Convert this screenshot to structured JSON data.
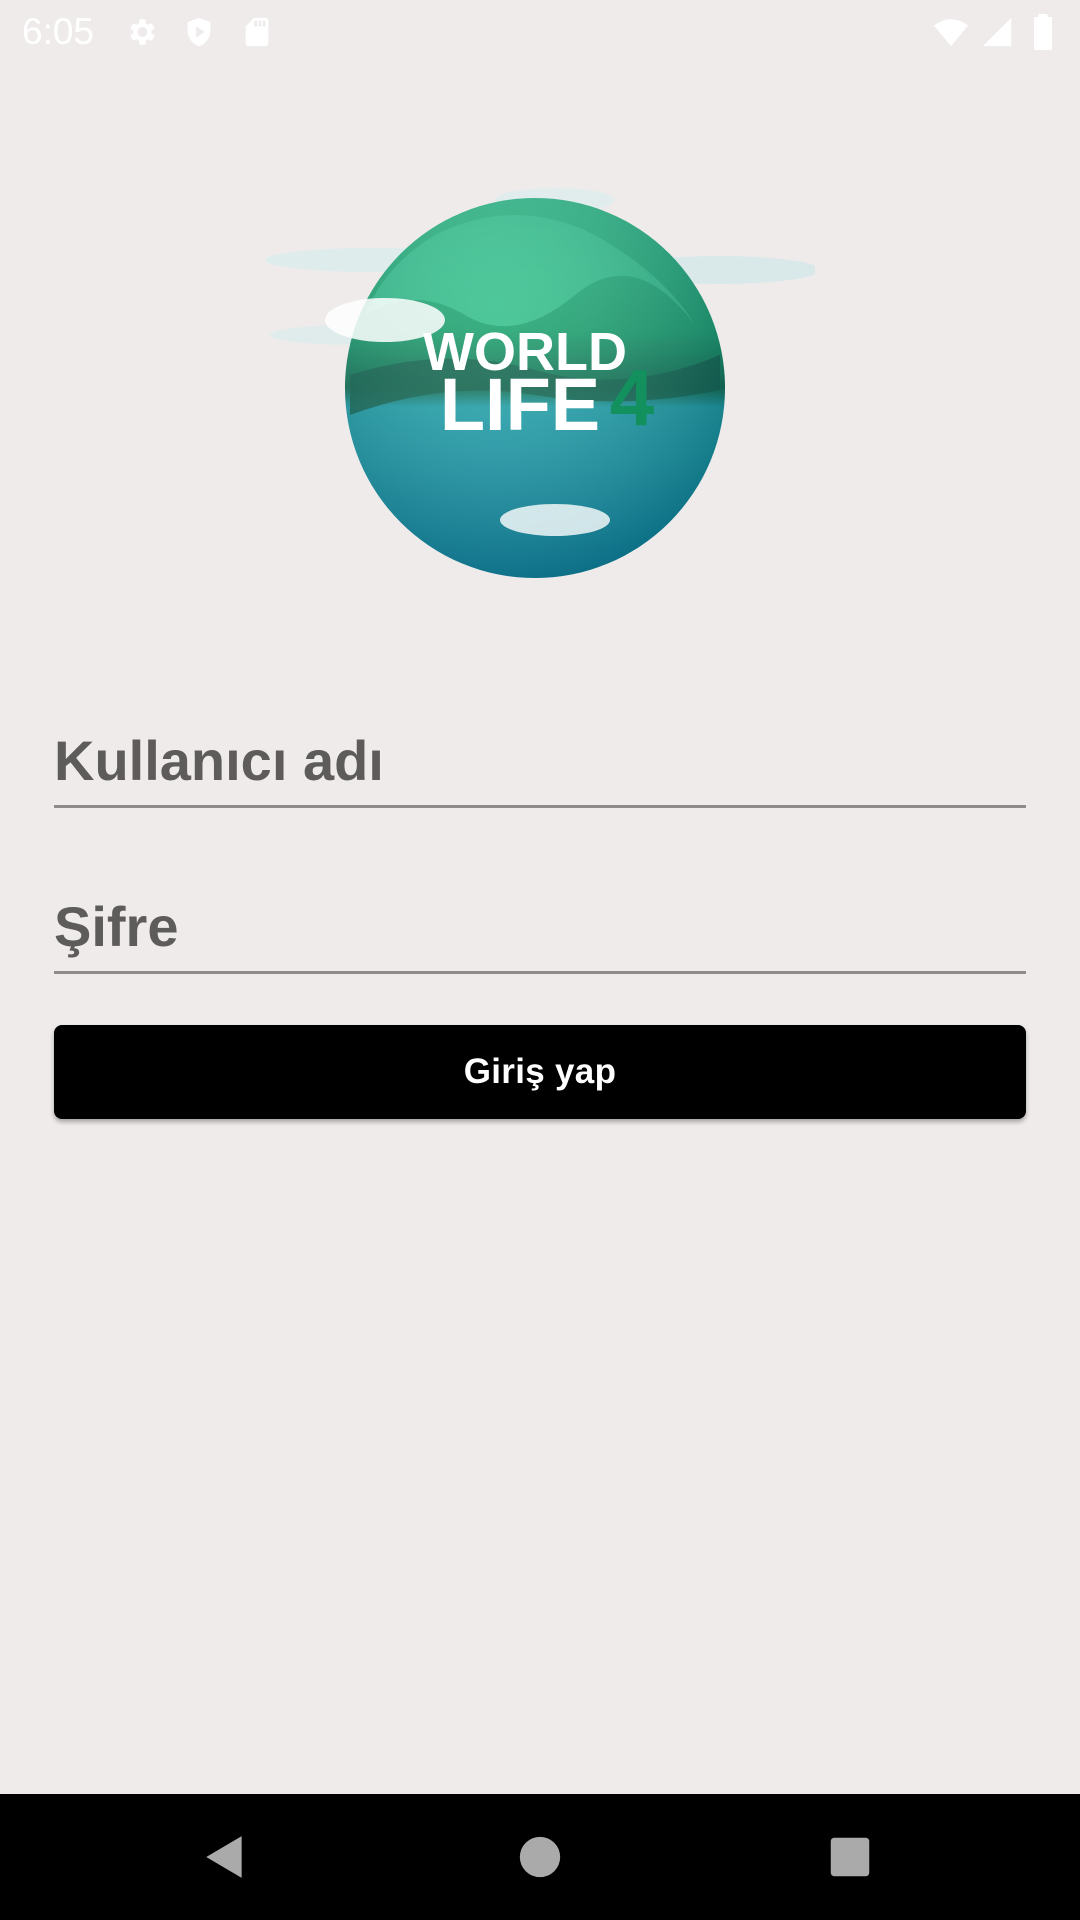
{
  "status_bar": {
    "time": "6:05",
    "icons": [
      "settings-icon",
      "shield-icon",
      "sd-card-icon",
      "wifi-icon",
      "signal-icon",
      "battery-icon"
    ]
  },
  "logo": {
    "line1": "WORLD",
    "line2": "LIFE",
    "number": "4",
    "colors": {
      "green": "#1f9e6a",
      "teal": "#17a4b4",
      "dark": "#0b5d47"
    }
  },
  "login_form": {
    "username_placeholder": "Kullanıcı adı",
    "password_placeholder": "Şifre",
    "submit_label": "Giriş yap"
  },
  "nav_bar": {
    "icons": [
      "back-icon",
      "home-icon",
      "recents-icon"
    ]
  }
}
